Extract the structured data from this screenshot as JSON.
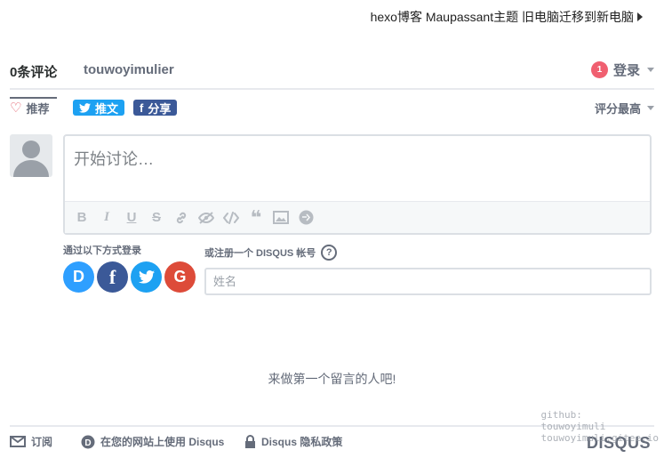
{
  "next_post": {
    "label": "hexo博客 Maupassant主题 旧电脑迁移到新电脑"
  },
  "nav": {
    "comment_count": "0条评论",
    "forum_name": "touwoyimulier",
    "notification_count": "1",
    "login_label": "登录"
  },
  "actions": {
    "recommend_label": "推荐",
    "tweet_label": "推文",
    "share_label": "分享",
    "sort_label": "评分最高"
  },
  "editor": {
    "placeholder": "开始讨论…",
    "toolbar_icons": [
      "bold-icon",
      "italic-icon",
      "underline-icon",
      "strikethrough-icon",
      "link-icon",
      "spoiler-icon",
      "code-icon",
      "quote-icon",
      "image-icon",
      "gif-icon"
    ]
  },
  "login": {
    "via_label": "通过以下方式登录",
    "providers": [
      {
        "name": "disqus",
        "glyph": "D",
        "color": "#2e9fff"
      },
      {
        "name": "facebook",
        "glyph": "f",
        "color": "#3b5998"
      },
      {
        "name": "twitter",
        "glyph": "t",
        "color": "#1da1f2"
      },
      {
        "name": "google",
        "glyph": "G",
        "color": "#dd4b39"
      }
    ],
    "signup_label": "或注册一个 DISQUS 帐号",
    "help_glyph": "?",
    "name_placeholder": "姓名"
  },
  "empty_message": "来做第一个留言的人吧!",
  "footer": {
    "subscribe_label": "订阅",
    "use_disqus_label": "在您的网站上使用 Disqus",
    "privacy_label": "Disqus 隐私政策",
    "brand": "DISQUS"
  },
  "watermark": {
    "line1": "github:",
    "line2": "touwoyimuli",
    "line3": "touwoyimuli.gitee.io"
  }
}
